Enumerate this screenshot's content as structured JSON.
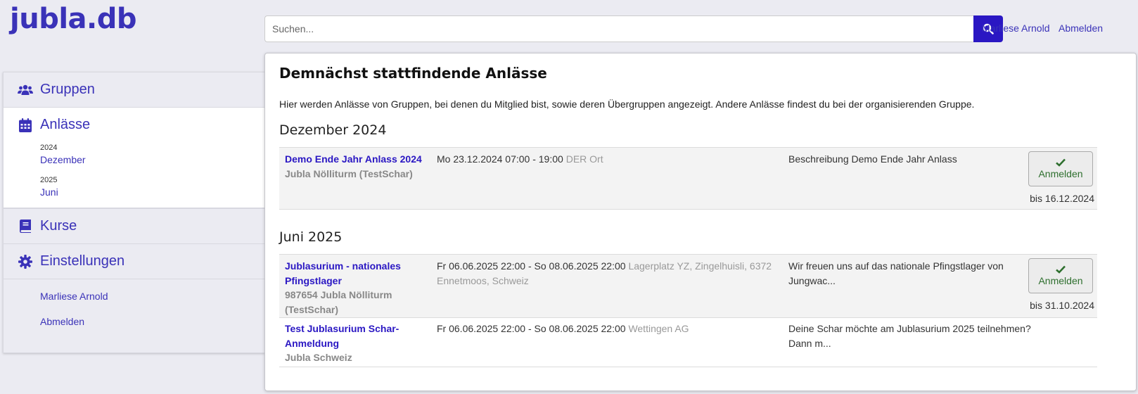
{
  "header": {
    "logo": "jubla.db",
    "search_placeholder": "Suchen...",
    "user_link": "Marliese Arnold",
    "logout_link": "Abmelden"
  },
  "sidebar": {
    "nav": [
      {
        "label": "Gruppen",
        "icon": "users-icon"
      },
      {
        "label": "Anlässe",
        "icon": "calendar-icon"
      },
      {
        "label": "Kurse",
        "icon": "book-icon"
      },
      {
        "label": "Einstellungen",
        "icon": "gear-icon"
      }
    ],
    "years": [
      {
        "year": "2024",
        "month": "Dezember"
      },
      {
        "year": "2025",
        "month": "Juni"
      }
    ],
    "user_link": "Marliese Arnold",
    "logout_link": "Abmelden"
  },
  "main": {
    "title": "Demnächst stattfindende Anlässe",
    "intro": "Hier werden Anlässe von Gruppen, bei denen du Mitglied bist, sowie deren Übergruppen angezeigt. Andere Anlässe findest du bei der organisierenden Gruppe.",
    "sections": [
      {
        "month": "Dezember 2024",
        "events": [
          {
            "title": "Demo Ende Jahr Anlass 2024",
            "group": "Jubla Nölliturm (TestSchar)",
            "dates": "Mo 23.12.2024 07:00 - 19:00",
            "location": "DER Ort",
            "description": "Beschreibung Demo Ende Jahr Anlass",
            "button": "Anmelden",
            "until": "bis 16.12.2024"
          }
        ]
      },
      {
        "month": "Juni 2025",
        "events": [
          {
            "title": "Jublasurium - nationales Pfingstlager",
            "group": "987654 Jubla Nölliturm (TestSchar)",
            "dates": "Fr 06.06.2025 22:00 - So 08.06.2025 22:00",
            "location": "Lagerplatz YZ, Zingelhuisli, 6372 Ennetmoos, Schweiz",
            "description": "Wir freuen uns auf das nationale Pfingstlager von Jungwac...",
            "button": "Anmelden",
            "until": "bis 31.10.2024"
          },
          {
            "title": "Test Jublasurium Schar-Anmeldung",
            "group": "Jubla Schweiz",
            "dates": "Fr 06.06.2025 22:00 - So 08.06.2025 22:00",
            "location": "Wettingen AG",
            "description": "Deine Schar möchte am Jublasurium 2025 teilnehmen? Dann m..."
          }
        ]
      }
    ]
  },
  "colors": {
    "brand": "#3a32b8",
    "search_button": "#2a17c3",
    "check": "#2e6f2e"
  }
}
